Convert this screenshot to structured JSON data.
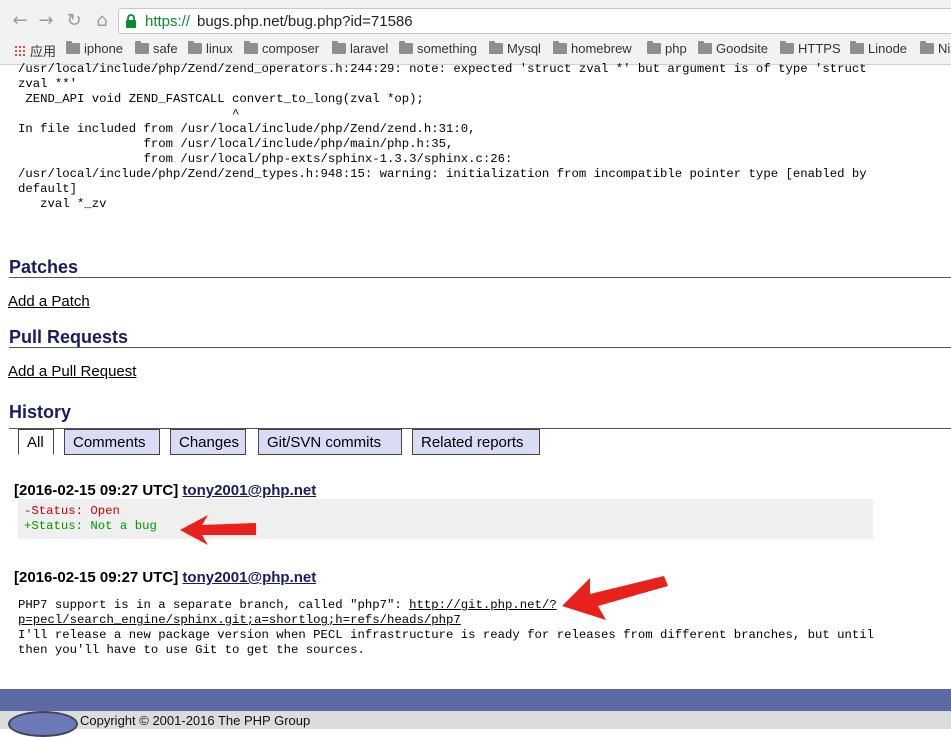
{
  "browser": {
    "url_scheme": "https://",
    "url_rest": "bugs.php.net/bug.php?id=71586",
    "nav_icons": [
      "back-icon",
      "forward-icon",
      "reload-icon",
      "home-icon"
    ],
    "bookmarks": [
      "应用",
      "iphone",
      "safe",
      "linux",
      "composer",
      "laravel",
      "something",
      "Mysql",
      "homebrew",
      "php",
      "Goodsite",
      "HTTPS",
      "Linode",
      "Ni"
    ]
  },
  "page": {
    "code_output": "/usr/local/include/php/Zend/zend_operators.h:244:29: note: expected 'struct zval *' but argument is of type 'struct\nzval **'\n ZEND_API void ZEND_FASTCALL convert_to_long(zval *op);\n                             ^\nIn file included from /usr/local/include/php/Zend/zend.h:31:0,\n                 from /usr/local/include/php/main/php.h:35,\n                 from /usr/local/php-exts/sphinx-1.3.3/sphinx.c:26:\n/usr/local/include/php/Zend/zend_types.h:948:15: warning: initialization from incompatible pointer type [enabled by\ndefault]\n   zval *_zv",
    "patches_title": "Patches",
    "add_patch": "Add a Patch",
    "pull_requests_title": "Pull Requests",
    "add_pull_request": "Add a Pull Request",
    "history_title": "History",
    "tabs": [
      "All",
      "Comments",
      "Changes",
      "Git/SVN commits",
      "Related reports"
    ],
    "entries": [
      {
        "date": "[2016-02-15 09:27 UTC]",
        "author": "tony2001@php.net",
        "diff_minus": "-Status: Open",
        "diff_plus": "+Status: Not a bug"
      },
      {
        "date": "[2016-02-15 09:27 UTC]",
        "author": "tony2001@php.net",
        "comment_pre": "PHP7 support is in a separate branch, called \"php7\": ",
        "comment_link_1": "http://git.php.net/?",
        "comment_link_2": "p=pecl/search_engine/sphinx.git;a=shortlog;h=refs/heads/php7",
        "comment_rest": "I'll release a new package version when PECL infrastructure is ready for releases from different branches, but until\nthen you'll have to use Git to get the sources."
      }
    ]
  },
  "footer": {
    "copyright": "Copyright © 2001-2016 The PHP Group"
  },
  "colors": {
    "heading": "#1a1a66",
    "tab_bg": "#d9dcf5",
    "arrow": "#e8221b",
    "footer_bar": "#5b6aa5"
  }
}
